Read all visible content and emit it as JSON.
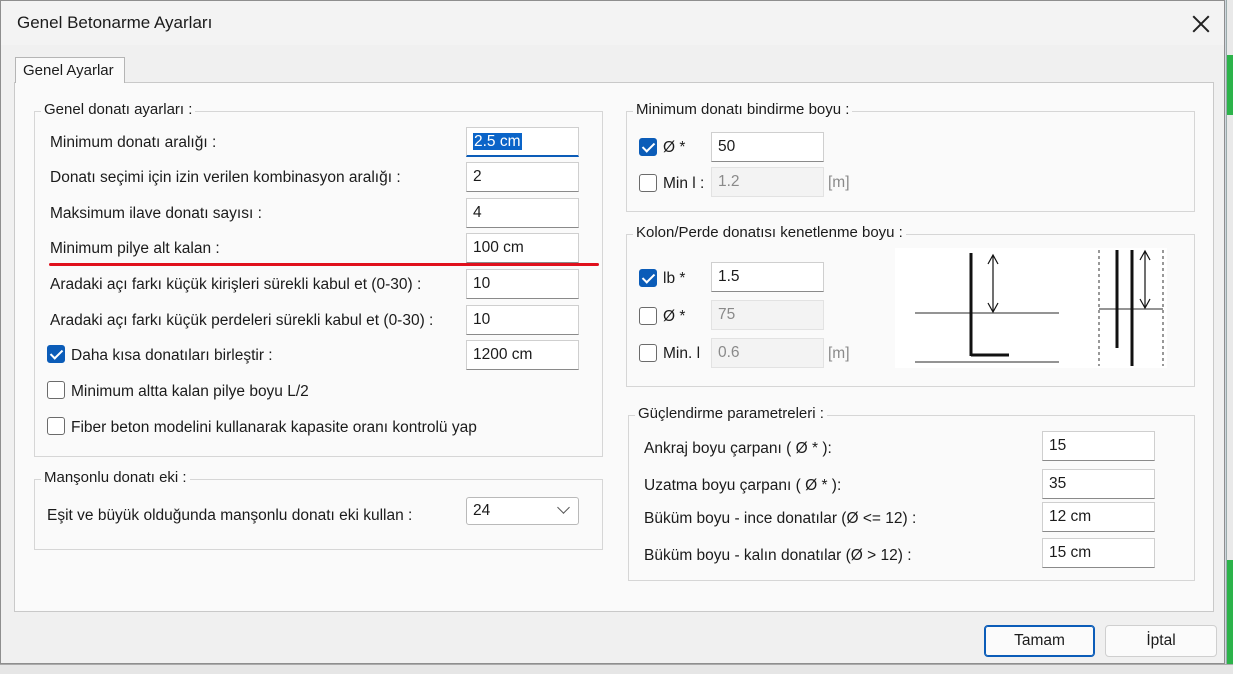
{
  "window": {
    "title": "Genel Betonarme Ayarları"
  },
  "tabs": [
    {
      "label": "Genel Ayarlar"
    }
  ],
  "genel_donati": {
    "title": "Genel donatı ayarları :",
    "rows": [
      {
        "label": "Minimum donatı aralığı :",
        "value": "2.5 cm"
      },
      {
        "label": "Donatı seçimi için izin verilen kombinasyon aralığı :",
        "value": "2"
      },
      {
        "label": "Maksimum ilave donatı sayısı :",
        "value": "4"
      },
      {
        "label": "Minimum pilye alt kalan :",
        "value": "100 cm"
      },
      {
        "label": "Aradaki açı farkı küçük kirişleri sürekli kabul et (0-30) :",
        "value": "10"
      },
      {
        "label": "Aradaki açı farkı küçük perdeleri sürekli kabul et (0-30) :",
        "value": "10"
      }
    ],
    "checkboxes": [
      {
        "label": "Daha kısa donatıları birleştir :",
        "checked": true,
        "value": "1200 cm"
      },
      {
        "label": "Minimum altta kalan pilye boyu L/2",
        "checked": false
      },
      {
        "label": "Fiber beton modelini kullanarak kapasite oranı kontrolü yap",
        "checked": false
      }
    ]
  },
  "mansonlu": {
    "title": "Manşonlu donatı eki :",
    "label": "Eşit ve büyük olduğunda manşonlu donatı eki kullan :",
    "selected": "24"
  },
  "bindirme": {
    "title": "Minimum donatı bindirme boyu :",
    "phi": {
      "label": "Ø *",
      "checked": true,
      "value": "50"
    },
    "min_l": {
      "label": "Min l :",
      "checked": false,
      "value": "1.2",
      "unit": "[m]"
    }
  },
  "kenetlenme": {
    "title": "Kolon/Perde donatısı kenetlenme boyu :",
    "lb": {
      "label": "lb *",
      "checked": true,
      "value": "1.5"
    },
    "phi": {
      "label": "Ø *",
      "checked": false,
      "value": "75"
    },
    "min_l": {
      "label": "Min. l",
      "checked": false,
      "value": "0.6",
      "unit": "[m]"
    }
  },
  "guclendirme": {
    "title": "Güçlendirme parametreleri :",
    "rows": [
      {
        "label": "Ankraj boyu çarpanı  ( Ø * ):",
        "value": "15"
      },
      {
        "label": "Uzatma boyu çarpanı  ( Ø * ):",
        "value": "35"
      },
      {
        "label": "Büküm boyu - ince donatılar (Ø <= 12) :",
        "value": "12 cm"
      },
      {
        "label": "Büküm boyu - kalın donatılar (Ø > 12) :",
        "value": "15 cm"
      }
    ]
  },
  "buttons": {
    "ok": "Tamam",
    "cancel": "İptal"
  },
  "colors": {
    "accent": "#0b5cb8",
    "highlight_line": "#e0101c"
  }
}
